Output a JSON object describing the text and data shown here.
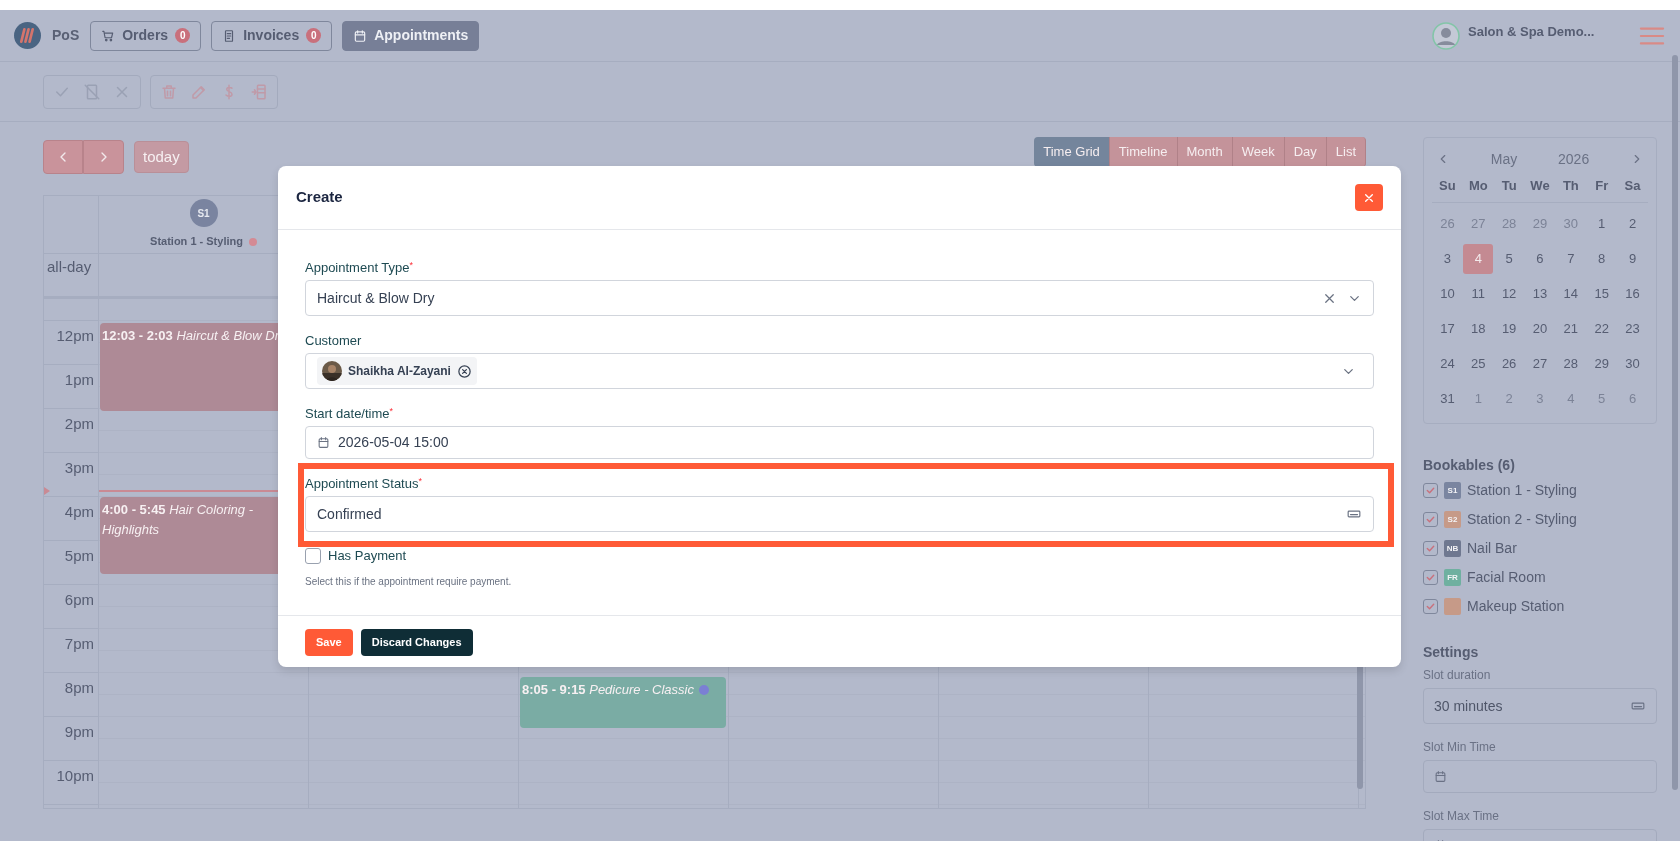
{
  "topbar": {
    "brand": "PoS",
    "nav": [
      {
        "label": "Orders",
        "count": "0",
        "kind": "cart",
        "selected": false
      },
      {
        "label": "Invoices",
        "count": "0",
        "kind": "receipt",
        "selected": false
      },
      {
        "label": "Appointments",
        "kind": "calendar",
        "selected": true
      }
    ],
    "account": {
      "name": "Salon & Spa Demo..."
    }
  },
  "toolbar": {
    "groups": [
      [
        {
          "kind": "check",
          "disabled": true
        },
        {
          "kind": "card-off",
          "disabled": true
        },
        {
          "kind": "close",
          "disabled": true
        }
      ],
      [
        {
          "kind": "trash",
          "disabled": true
        },
        {
          "kind": "edit",
          "disabled": true
        },
        {
          "kind": "dollar",
          "disabled": true
        },
        {
          "kind": "export",
          "disabled": true
        }
      ]
    ]
  },
  "calendar": {
    "today": "today",
    "views": [
      {
        "label": "Time Grid",
        "selected": true
      },
      {
        "label": "Timeline",
        "selected": false
      },
      {
        "label": "Month",
        "selected": false
      },
      {
        "label": "Week",
        "selected": false
      },
      {
        "label": "Day",
        "selected": false
      },
      {
        "label": "List",
        "selected": false
      }
    ],
    "resources": [
      {
        "badge": "S1",
        "name": "Station 1 - Styling",
        "color": "#d48a94"
      }
    ],
    "allday": "all-day",
    "hours": [
      "12pm",
      "1pm",
      "2pm",
      "3pm",
      "4pm",
      "5pm",
      "6pm",
      "7pm",
      "8pm",
      "9pm",
      "10pm"
    ],
    "events": [
      {
        "label": "**12:03 - 2:03** Haircut & Blow Dr",
        "color": "#ae8a96"
      },
      {
        "label": "**4:00 - 5:45** Hair Coloring - Highlights",
        "color": "#ae8a96"
      },
      {
        "label": "**8:05 - 9:15** Pedicure - Classic",
        "color": "#7aaca4",
        "dot": {
          "color": "#7b7fd4"
        }
      }
    ]
  },
  "mini_calendar": {
    "month": "May",
    "year": "2026",
    "weekdays": [
      "Su",
      "Mo",
      "Tu",
      "We",
      "Th",
      "Fr",
      "Sa"
    ],
    "days": [
      {
        "label": "26",
        "muted": true,
        "selected": false
      },
      {
        "label": "27",
        "muted": true,
        "selected": false
      },
      {
        "label": "28",
        "muted": true,
        "selected": false
      },
      {
        "label": "29",
        "muted": true,
        "selected": false
      },
      {
        "label": "30",
        "muted": true,
        "selected": false
      },
      {
        "label": "1",
        "muted": false,
        "selected": false
      },
      {
        "label": "2",
        "muted": false,
        "selected": false
      },
      {
        "label": "3",
        "muted": false,
        "selected": false
      },
      {
        "label": "4",
        "muted": false,
        "selected": true
      },
      {
        "label": "5",
        "muted": false,
        "selected": false
      },
      {
        "label": "6",
        "muted": false,
        "selected": false
      },
      {
        "label": "7",
        "muted": false,
        "selected": false
      },
      {
        "label": "8",
        "muted": false,
        "selected": false
      },
      {
        "label": "9",
        "muted": false,
        "selected": false
      },
      {
        "label": "10",
        "muted": false,
        "selected": false
      },
      {
        "label": "11",
        "muted": false,
        "selected": false
      },
      {
        "label": "12",
        "muted": false,
        "selected": false
      },
      {
        "label": "13",
        "muted": false,
        "selected": false
      },
      {
        "label": "14",
        "muted": false,
        "selected": false
      },
      {
        "label": "15",
        "muted": false,
        "selected": false
      },
      {
        "label": "16",
        "muted": false,
        "selected": false
      },
      {
        "label": "17",
        "muted": false,
        "selected": false
      },
      {
        "label": "18",
        "muted": false,
        "selected": false
      },
      {
        "label": "19",
        "muted": false,
        "selected": false
      },
      {
        "label": "20",
        "muted": false,
        "selected": false
      },
      {
        "label": "21",
        "muted": false,
        "selected": false
      },
      {
        "label": "22",
        "muted": false,
        "selected": false
      },
      {
        "label": "23",
        "muted": false,
        "selected": false
      },
      {
        "label": "24",
        "muted": false,
        "selected": false
      },
      {
        "label": "25",
        "muted": false,
        "selected": false
      },
      {
        "label": "26",
        "muted": false,
        "selected": false
      },
      {
        "label": "27",
        "muted": false,
        "selected": false
      },
      {
        "label": "28",
        "muted": false,
        "selected": false
      },
      {
        "label": "29",
        "muted": false,
        "selected": false
      },
      {
        "label": "30",
        "muted": false,
        "selected": false
      },
      {
        "label": "31",
        "muted": false,
        "selected": false
      },
      {
        "label": "1",
        "muted": true,
        "selected": false
      },
      {
        "label": "2",
        "muted": true,
        "selected": false
      },
      {
        "label": "3",
        "muted": true,
        "selected": false
      },
      {
        "label": "4",
        "muted": true,
        "selected": false
      },
      {
        "label": "5",
        "muted": true,
        "selected": false
      },
      {
        "label": "6",
        "muted": true,
        "selected": false
      }
    ]
  },
  "bookables": {
    "title": "Bookables (6)",
    "items": [
      {
        "badge": "S1",
        "name": "Station 1 - Styling",
        "checked": true,
        "color": "#7a85a0"
      },
      {
        "badge": "S2",
        "name": "Station 2 - Styling",
        "checked": true,
        "color": "#c69a88"
      },
      {
        "badge": "NB",
        "name": "Nail Bar",
        "checked": true,
        "color": "#6f7890"
      },
      {
        "badge": "FR",
        "name": "Facial Room",
        "checked": true,
        "color": "#6fb0a0"
      },
      {
        "name": "Makeup Station",
        "checked": true,
        "color": "#c69a88"
      }
    ]
  },
  "settings": {
    "title": "Settings",
    "fields": [
      {
        "label": "Slot duration",
        "kind": "select",
        "value": "30 minutes"
      },
      {
        "label": "Slot Min Time",
        "kind": "time"
      },
      {
        "label": "Slot Max Time",
        "kind": "time"
      }
    ]
  },
  "dialog": {
    "title": "Create",
    "fields": [
      {
        "kind": "select",
        "label": "Appointment Type$^{*}$",
        "value": "Haircut & Blow Dry",
        "clearable": true
      },
      {
        "kind": "tags",
        "label": "Customer",
        "tags": [
          {
            "label": "Shaikha Al-Zayani"
          }
        ]
      },
      {
        "kind": "date",
        "label": "Start date/time$^{*}$",
        "value": "2026-05-04 15:00"
      },
      {
        "kind": "status",
        "label": "Appointment Status$^{*}$",
        "value": "Confirmed",
        "highlighted": true
      },
      {
        "kind": "checkbox",
        "label": "Has Payment",
        "checked": false,
        "help": "Select this if the appointment require payment."
      }
    ],
    "buttons": [
      {
        "label": "Save",
        "kind": "primary"
      },
      {
        "label": "Discard Changes",
        "kind": "secondary"
      }
    ]
  }
}
